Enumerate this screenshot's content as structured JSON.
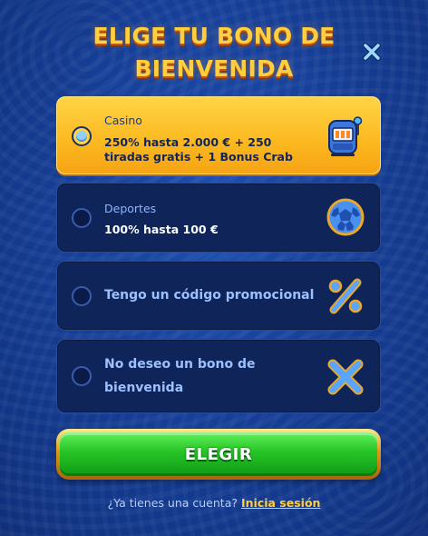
{
  "title": {
    "line1": "ELIGE TU BONO DE",
    "line2": "BIENVENIDA"
  },
  "options": [
    {
      "category": "Casino",
      "description": "250% hasta 2.000 € + 250 tiradas gratis + 1 Bonus Crab",
      "icon": "slot-machine-icon",
      "selected": true
    },
    {
      "category": "Deportes",
      "description": "100% hasta 100 €",
      "icon": "soccer-ball-icon",
      "selected": false
    },
    {
      "label": "Tengo un código promocional",
      "icon": "percent-icon",
      "selected": false
    },
    {
      "label_line1": "No deseo un bono de",
      "label_line2": "bienvenida",
      "icon": "x-mark-icon",
      "selected": false
    }
  ],
  "button": {
    "label": "ELEGIR"
  },
  "footer": {
    "question": "¿Ya tienes una cuenta?",
    "link": "Inicia sesión"
  },
  "colors": {
    "background": "#163f98",
    "selected_card": "#fbb81f",
    "card": "#0f2459",
    "title": "#ffcf3f",
    "button_green": "#26c426",
    "link": "#ffcf3f"
  }
}
